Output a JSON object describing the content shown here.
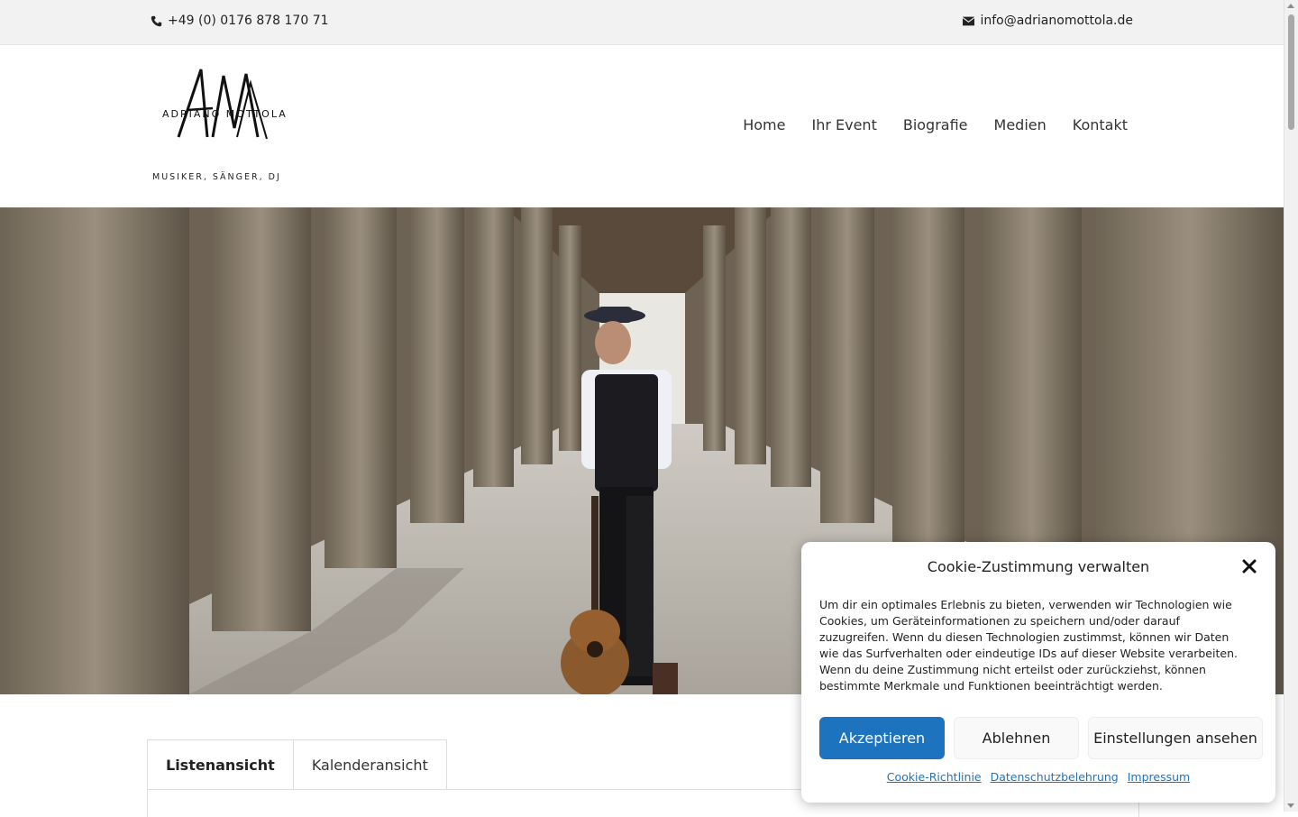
{
  "topbar": {
    "phone": "+49 (0) 0176 878 170 71",
    "email": "info@adrianomottola.de"
  },
  "header": {
    "logo_name": "ADRIANO MOTTOLA",
    "tagline": "MUSIKER, SÄNGER, DJ",
    "nav": [
      "Home",
      "Ihr Event",
      "Biografie",
      "Medien",
      "Kontakt"
    ]
  },
  "tabs": [
    "Listenansicht",
    "Kalenderansicht"
  ],
  "cookie": {
    "title": "Cookie-Zustimmung verwalten",
    "body": "Um dir ein optimales Erlebnis zu bieten, verwenden wir Technologien wie Cookies, um Geräteinformationen zu speichern und/oder darauf zuzugreifen. Wenn du diesen Technologien zustimmst, können wir Daten wie das Surfverhalten oder eindeutige IDs auf dieser Website verarbeiten. Wenn du deine Zustimmung nicht erteilst oder zurückziehst, können bestimmte Merkmale und Funktionen beeinträchtigt werden.",
    "accept": "Akzeptieren",
    "deny": "Ablehnen",
    "prefs": "Einstellungen ansehen",
    "links": [
      "Cookie-Richtlinie",
      "Datenschutzbelehrung",
      "Impressum"
    ]
  },
  "colors": {
    "accent": "#1e73be",
    "topbar_bg": "#f2f2f2"
  },
  "icons": {
    "phone": "phone-icon",
    "mail": "envelope-icon",
    "close": "close-icon"
  }
}
